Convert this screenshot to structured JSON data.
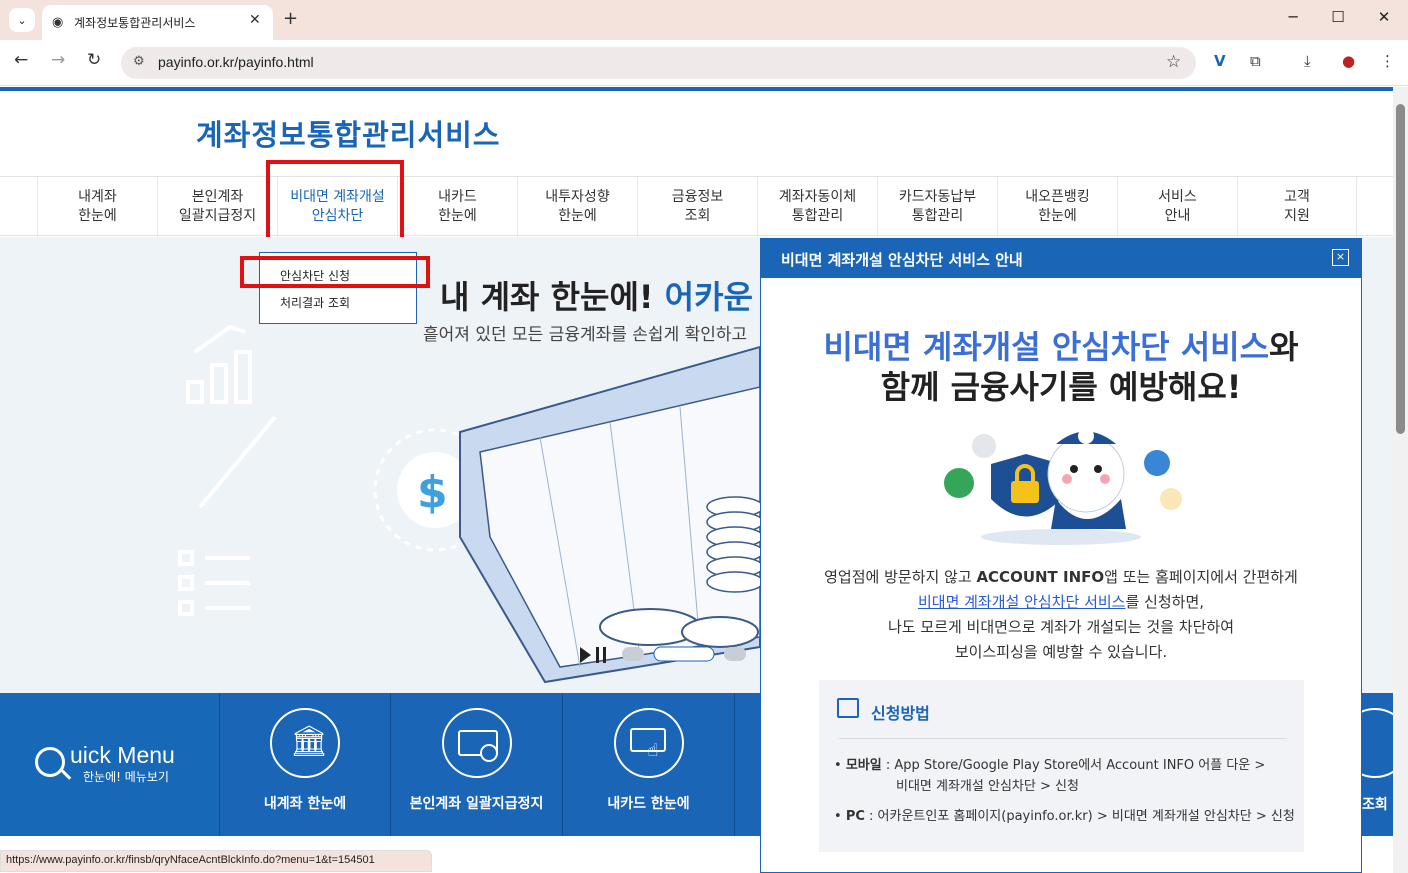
{
  "browser": {
    "tab_title": "계좌정보통합관리서비스",
    "new_tab": "+",
    "url": "payinfo.or.kr/payinfo.html",
    "status_url": "https://www.payinfo.or.kr/finsb/qryNfaceAcntBlckInfo.do?menu=1&t=154501"
  },
  "site": {
    "title": "계좌정보통합관리서비스",
    "gnb": [
      {
        "label": "내계좌\n한눈에"
      },
      {
        "label": "본인계좌\n일괄지급정지"
      },
      {
        "label": "비대면 계좌개설\n안심차단"
      },
      {
        "label": "내카드\n한눈에"
      },
      {
        "label": "내투자성향\n한눈에"
      },
      {
        "label": "금융정보\n조회"
      },
      {
        "label": "계좌자동이체\n통합관리"
      },
      {
        "label": "카드자동납부\n통합관리"
      },
      {
        "label": "내오픈뱅킹\n한눈에"
      },
      {
        "label": "서비스\n안내"
      },
      {
        "label": "고객\n지원"
      }
    ],
    "submenu": [
      {
        "label": "안심차단 신청"
      },
      {
        "label": "처리결과 조회"
      }
    ],
    "hero": {
      "title_main": "내 계좌 한눈에! ",
      "title_highlight": "어카운",
      "subtitle": "흩어져 있던 모든 금융계좌를 손쉽게 확인하고"
    },
    "quick_menu": {
      "title": "uick Menu",
      "subtitle": "한눈에! 메뉴보기",
      "items": [
        {
          "label": "내계좌 한눈에",
          "icon": "bank-icon"
        },
        {
          "label": "본인계좌 일괄지급정지",
          "icon": "card-block-icon"
        },
        {
          "label": "내카드 한눈에",
          "icon": "card-hand-icon"
        }
      ],
      "right_label": "조회"
    }
  },
  "popup": {
    "header": "비대면 계좌개설 안심차단 서비스 안내",
    "close": "×",
    "headline_hl": "비대면 계좌개설 안심차단 서비스",
    "headline_rest": "와",
    "headline_line2": "함께 금융사기를 예방해요!",
    "desc_1a": "영업점에 방문하지 않고 ",
    "desc_1b": "ACCOUNT INFO",
    "desc_1c": "앱 또는 홈페이지에서 간편하게",
    "desc_2_link": "비대면 계좌개설 안심차단 서비스",
    "desc_2_rest": "를 신청하면,",
    "desc_3": "나도 모르게 비대면으로 계좌가 개설되는 것을 차단하여",
    "desc_4": "보이스피싱을 예방할 수 있습니다.",
    "method_title": "신청방법",
    "mobile_label": "모바일",
    "mobile_text": " : App Store/Google Play Store에서 Account INFO 어플 다운 >",
    "mobile_text2": "비대면 계좌개설 안심차단 > 신청",
    "pc_label": "PC",
    "pc_text": " : 어카운트인포 홈페이지(payinfo.or.kr) > 비대면 계좌개설 안심차단 > 신청"
  },
  "colors": {
    "brand": "#1b65b6",
    "highlight_box": "#e21111"
  }
}
